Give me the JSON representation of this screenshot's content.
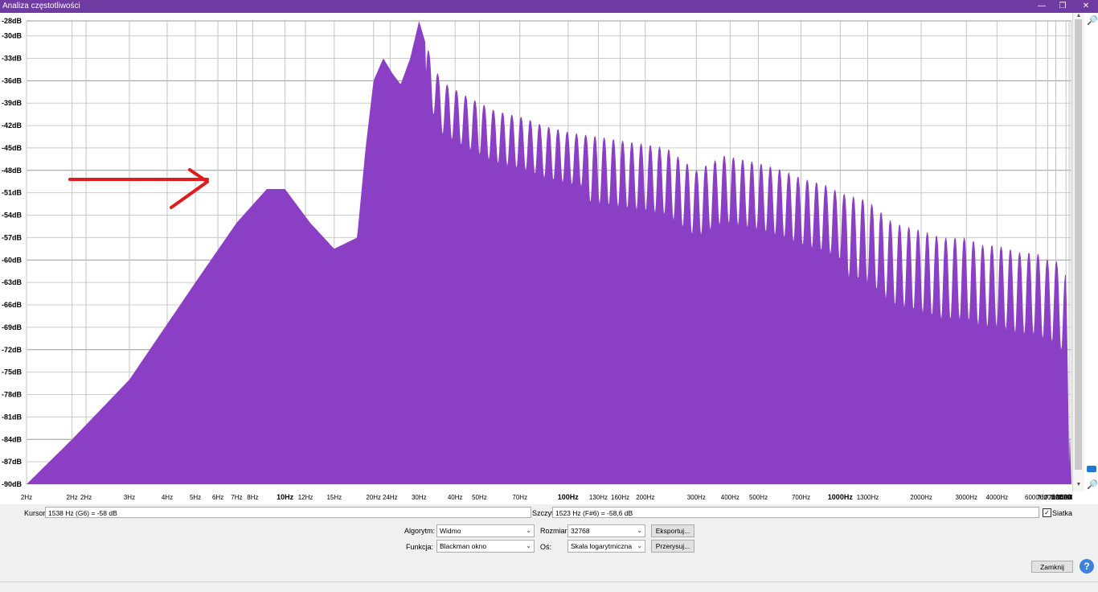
{
  "window": {
    "title": "Analiza częstotliwości",
    "minimize": "—",
    "restore": "❐",
    "close": "✕"
  },
  "chart_data": {
    "type": "area",
    "fill_color": "#8a3fc4",
    "arrow_color": "#e01b1b",
    "x_scale": "log",
    "xlim": [
      2,
      22050
    ],
    "ylim": [
      -90,
      -28
    ],
    "grid": true,
    "y_ticks": [
      "-28dB",
      "-30dB",
      "-33dB",
      "-36dB",
      "-39dB",
      "-42dB",
      "-45dB",
      "-48dB",
      "-51dB",
      "-54dB",
      "-57dB",
      "-60dB",
      "-63dB",
      "-66dB",
      "-69dB",
      "-72dB",
      "-75dB",
      "-78dB",
      "-81dB",
      "-84dB",
      "-87dB",
      "-90dB"
    ],
    "y_tick_values": [
      -28,
      -30,
      -33,
      -36,
      -39,
      -42,
      -45,
      -48,
      -51,
      -54,
      -57,
      -60,
      -63,
      -66,
      -69,
      -72,
      -75,
      -78,
      -81,
      -84,
      -87,
      -90
    ],
    "x_ticks": [
      {
        "label": "2Hz",
        "value": 2
      },
      {
        "label": "2Hz",
        "value": 3
      },
      {
        "label": "2Hz",
        "value": 3.4
      },
      {
        "label": "3Hz",
        "value": 5
      },
      {
        "label": "4Hz",
        "value": 7
      },
      {
        "label": "5Hz",
        "value": 9
      },
      {
        "label": "6Hz",
        "value": 11
      },
      {
        "label": "7Hz",
        "value": 13
      },
      {
        "label": "8Hz",
        "value": 15
      },
      {
        "label": "10Hz",
        "value": 20
      },
      {
        "label": "12Hz",
        "value": 24
      },
      {
        "label": "15Hz",
        "value": 31
      },
      {
        "label": "20Hz",
        "value": 44
      },
      {
        "label": "24Hz",
        "value": 51
      },
      {
        "label": "30Hz",
        "value": 66
      },
      {
        "label": "40Hz",
        "value": 91
      },
      {
        "label": "50Hz",
        "value": 113
      },
      {
        "label": "70Hz",
        "value": 162
      },
      {
        "label": "100Hz",
        "value": 249
      },
      {
        "label": "130Hz",
        "value": 326
      },
      {
        "label": "160Hz",
        "value": 396
      },
      {
        "label": "200Hz",
        "value": 495
      },
      {
        "label": "300Hz",
        "value": 780
      },
      {
        "label": "400Hz",
        "value": 1054
      },
      {
        "label": "500Hz",
        "value": 1356
      },
      {
        "label": "700Hz",
        "value": 1982
      },
      {
        "label": "1000Hz",
        "value": 2811
      },
      {
        "label": "1300Hz",
        "value": 3590
      },
      {
        "label": "2000Hz",
        "value": 5783
      },
      {
        "label": "3000Hz",
        "value": 8646
      },
      {
        "label": "4000Hz",
        "value": 11356
      },
      {
        "label": "6000Hz",
        "value": 16072
      },
      {
        "label": "7000Hz",
        "value": 17838
      },
      {
        "label": "7700Hz",
        "value": 19166
      },
      {
        "label": "10000Hz",
        "value": 21000
      },
      {
        "label": "14000Hz",
        "value": 21600
      },
      {
        "label": "20000Hz",
        "value": 22000
      }
    ],
    "bold_ticks": [
      "10Hz",
      "100Hz",
      "1000Hz",
      "10000Hz"
    ],
    "envelope": [
      [
        2,
        -90
      ],
      [
        3,
        -84
      ],
      [
        5,
        -76
      ],
      [
        9,
        -63
      ],
      [
        13,
        -55
      ],
      [
        17,
        -50.5
      ],
      [
        20,
        -50.5
      ],
      [
        25,
        -55
      ],
      [
        31,
        -58.5
      ],
      [
        38,
        -57
      ],
      [
        41,
        -45
      ],
      [
        44,
        -36
      ],
      [
        48,
        -33
      ],
      [
        52,
        -35
      ],
      [
        56,
        -36.5
      ],
      [
        61,
        -33
      ],
      [
        66,
        -28
      ],
      [
        70,
        -31
      ],
      [
        80,
        -36
      ],
      [
        100,
        -38
      ],
      [
        130,
        -40
      ],
      [
        170,
        -41
      ],
      [
        200,
        -42
      ],
      [
        260,
        -43
      ],
      [
        330,
        -43.5
      ],
      [
        400,
        -44
      ],
      [
        500,
        -44.5
      ],
      [
        600,
        -45
      ],
      [
        780,
        -48
      ],
      [
        1000,
        -46
      ],
      [
        1356,
        -47
      ],
      [
        1700,
        -48
      ],
      [
        1982,
        -49
      ],
      [
        2500,
        -50
      ],
      [
        2811,
        -51
      ],
      [
        3590,
        -52
      ],
      [
        4500,
        -55
      ],
      [
        5783,
        -56
      ],
      [
        7000,
        -57
      ],
      [
        8646,
        -57
      ],
      [
        10000,
        -58
      ],
      [
        11356,
        -58
      ],
      [
        14000,
        -59
      ],
      [
        16072,
        -59
      ],
      [
        18000,
        -60
      ],
      [
        19166,
        -60
      ],
      [
        20000,
        -61
      ],
      [
        21000,
        -62
      ],
      [
        21600,
        -80
      ],
      [
        22000,
        -90
      ]
    ]
  },
  "scrollbar": {
    "up": "▲",
    "down": "▼"
  },
  "zoom": {
    "in": "🔎",
    "out": "🔎"
  },
  "bottom": {
    "cursor_label": "Kursor:",
    "cursor_value": "1538 Hz (G6) = -58 dB",
    "peak_label": "Szczyt:",
    "peak_value": "1523 Hz (F#6) = -58,6 dB",
    "grid_label": "Siatka",
    "grid_checked": "✓",
    "algorithm_label": "Algorytm:",
    "algorithm_value": "Widmo",
    "size_label": "Rozmiar:",
    "size_value": "32768",
    "export_button": "Eksportuj...",
    "function_label": "Funkcja:",
    "function_value": "Blackman okno",
    "axis_label": "Oś:",
    "axis_value": "Skala logarytmiczna",
    "redraw_button": "Przerysuj...",
    "close_button": "Zamknij",
    "help_button": "?",
    "caret": "⌄"
  }
}
